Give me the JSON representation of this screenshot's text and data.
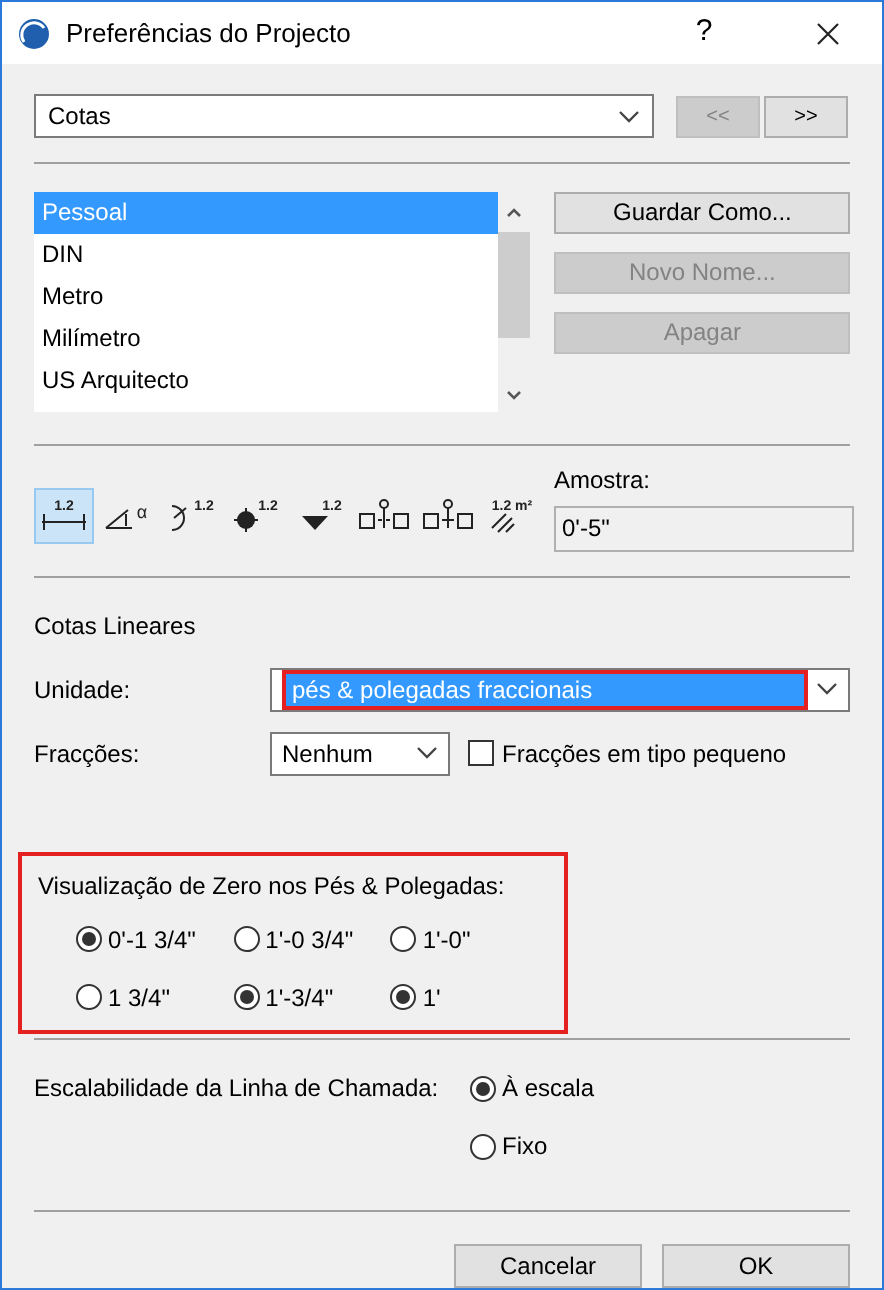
{
  "window": {
    "title": "Preferências do Projecto",
    "help": "?"
  },
  "category": {
    "value": "Cotas",
    "prev": "<<",
    "next": ">>",
    "prev_disabled": true
  },
  "presets": {
    "items": [
      {
        "label": "Pessoal",
        "selected": true
      },
      {
        "label": "DIN",
        "selected": false
      },
      {
        "label": "Metro",
        "selected": false
      },
      {
        "label": "Milímetro",
        "selected": false
      },
      {
        "label": "US Arquitecto",
        "selected": false
      }
    ],
    "buttons": [
      {
        "label": "Guardar Como...",
        "disabled": false
      },
      {
        "label": "Novo Nome...",
        "disabled": true
      },
      {
        "label": "Apagar",
        "disabled": true
      }
    ]
  },
  "tools": [
    {
      "kind": "linear",
      "label": "1.2",
      "selected": true
    },
    {
      "kind": "angle",
      "label": "α",
      "selected": false
    },
    {
      "kind": "radial",
      "label": "1.2",
      "selected": false
    },
    {
      "kind": "level",
      "label": "1.2",
      "selected": false
    },
    {
      "kind": "elevation",
      "label": "1.2",
      "selected": false
    },
    {
      "kind": "door",
      "selected": false
    },
    {
      "kind": "window",
      "selected": false
    },
    {
      "kind": "area",
      "label": "1.2 m²",
      "selected": false
    }
  ],
  "sample": {
    "label": "Amostra:",
    "value": "0'-5\""
  },
  "linear": {
    "title": "Cotas Lineares",
    "unit": {
      "label": "Unidade:",
      "value": "pés & polegadas fraccionais",
      "highlighted": true
    },
    "fractions": {
      "label": "Fracções:",
      "value": "Nenhum",
      "checkbox": {
        "label": "Fracções em tipo pequeno",
        "checked": false
      }
    }
  },
  "zero_display": {
    "title": "Visualização de Zero nos Pés & Polegadas:",
    "highlighted": true,
    "columns": [
      [
        {
          "label": "0'-1 3/4\"",
          "selected": true
        },
        {
          "label": "1 3/4\"",
          "selected": false
        }
      ],
      [
        {
          "label": "1'-0 3/4\"",
          "selected": false
        },
        {
          "label": "1'-3/4\"",
          "selected": true
        }
      ],
      [
        {
          "label": "1'-0\"",
          "selected": false
        },
        {
          "label": "1'",
          "selected": true
        }
      ]
    ]
  },
  "leader_scaling": {
    "label": "Escalabilidade da Linha de Chamada:",
    "options": [
      {
        "label": "À escala",
        "selected": true
      },
      {
        "label": "Fixo",
        "selected": false
      }
    ]
  },
  "buttons": [
    "Cancelar",
    "OK"
  ]
}
